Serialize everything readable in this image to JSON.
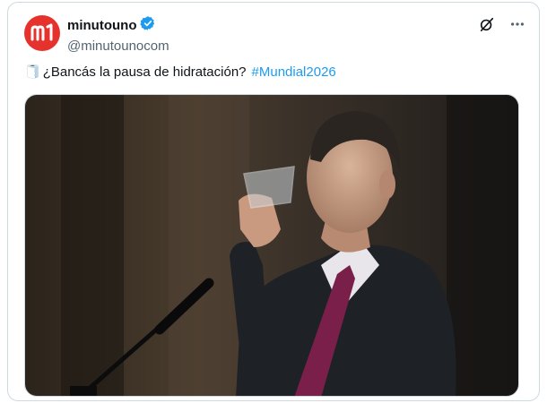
{
  "author": {
    "display_name": "minutouno",
    "handle": "@minutounocom",
    "verified": true,
    "avatar_text": "m1",
    "avatar_color": "#e5322d"
  },
  "actions": {
    "grok_icon": "grok-icon",
    "more_icon": "more-icon"
  },
  "tweet": {
    "emoji": "🧻",
    "text": "¿Bancás la pausa de hidratación?",
    "hashtag": "#Mundial2026"
  },
  "colors": {
    "hashtag": "#1d9bf0",
    "verified": "#1d9bf0"
  }
}
